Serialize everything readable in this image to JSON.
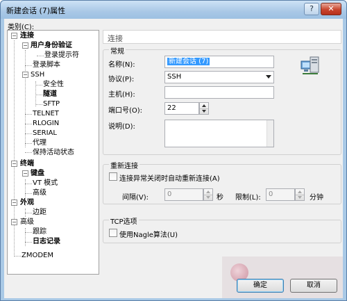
{
  "window": {
    "title": "新建会话 (7)属性",
    "help_glyph": "?",
    "close_glyph": "✕"
  },
  "category_label": "类别(C):",
  "tree": {
    "connection": "连接",
    "auth": "用户身份验证",
    "login_prompt": "登录提示符",
    "login_script": "登录脚本",
    "ssh": "SSH",
    "security": "安全性",
    "tunnel": "隧道",
    "sftp": "SFTP",
    "telnet": "TELNET",
    "rlogin": "RLOGIN",
    "serial": "SERIAL",
    "proxy": "代理",
    "keepalive": "保持活动状态",
    "terminal": "终端",
    "keyboard": "键盘",
    "vt_mode": "VT 模式",
    "terminal_advanced": "高级",
    "appearance": "外观",
    "margin": "边距",
    "advanced": "高级",
    "trace": "跟踪",
    "logging": "日志记录",
    "zmodem": "ZMODEM",
    "expand_minus": "−"
  },
  "panel": {
    "header": "连接",
    "general": {
      "title": "常规",
      "name_label": "名称(N):",
      "name_value": "新建会话 (7)",
      "protocol_label": "协议(P):",
      "protocol_value": "SSH",
      "host_label": "主机(H):",
      "host_value": "",
      "port_label": "端口号(O):",
      "port_value": "22",
      "desc_label": "说明(D):",
      "desc_value": ""
    },
    "reconnect": {
      "title": "重新连接",
      "auto_label": "连接异常关闭时自动重新连接(A)",
      "interval_label": "间隔(V):",
      "interval_value": "0",
      "seconds_unit": "秒",
      "limit_label": "限制(L):",
      "limit_value": "0",
      "minutes_unit": "分钟"
    },
    "tcp": {
      "title": "TCP选项",
      "nagle_label": "使用Nagle算法(U)"
    }
  },
  "buttons": {
    "ok": "确定",
    "cancel": "取消"
  },
  "colors": {
    "selection": "#3399ff",
    "titlebar": "#a9c9e6"
  }
}
